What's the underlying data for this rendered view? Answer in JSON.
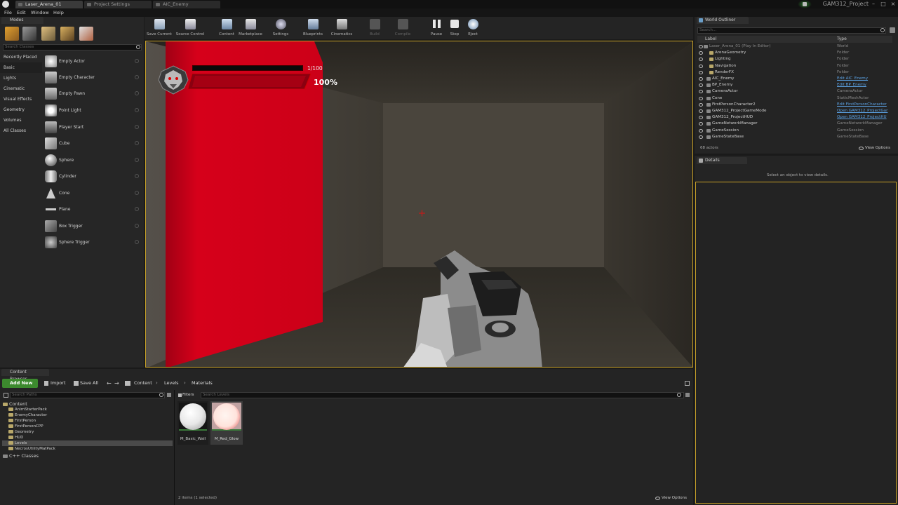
{
  "window": {
    "tabs": [
      "Laser_Arena_01",
      "Project Settings",
      "AIC_Enemy"
    ],
    "project_name": "GAM312_Project"
  },
  "menu": [
    "File",
    "Edit",
    "Window",
    "Help"
  ],
  "modes": {
    "tab": "Modes",
    "search_placeholder": "Search Classes",
    "categories": [
      "Recently Placed",
      "Basic",
      "Lights",
      "Cinematic",
      "Visual Effects",
      "Geometry",
      "Volumes",
      "All Classes"
    ],
    "selected_category": "Basic",
    "items": [
      "Empty Actor",
      "Empty Character",
      "Empty Pawn",
      "Point Light",
      "Player Start",
      "Cube",
      "Sphere",
      "Cylinder",
      "Cone",
      "Plane",
      "Box Trigger",
      "Sphere Trigger"
    ]
  },
  "toolbar": {
    "buttons": [
      "Save Current",
      "Source Control",
      "Content",
      "Marketplace",
      "Settings",
      "Blueprints",
      "Cinematics",
      "Build",
      "Compile",
      "Pause",
      "Stop",
      "Eject"
    ]
  },
  "hud": {
    "ammo": "1/100",
    "health": "100%"
  },
  "outliner": {
    "tab": "World Outliner",
    "search_placeholder": "Search...",
    "col_label": "Label",
    "col_type": "Type",
    "rows": [
      {
        "name": "Laser_Arena_01 (Play In Editor)",
        "type": "World",
        "link": false
      },
      {
        "name": "ArenaGeometry",
        "type": "Folder",
        "link": false
      },
      {
        "name": "Lighting",
        "type": "Folder",
        "link": false
      },
      {
        "name": "Navigation",
        "type": "Folder",
        "link": false
      },
      {
        "name": "RenderFX",
        "type": "Folder",
        "link": false
      },
      {
        "name": "AIC_Enemy",
        "type": "Edit AIC_Enemy",
        "link": true
      },
      {
        "name": "BP_Enemy",
        "type": "Edit BP_Enemy",
        "link": true
      },
      {
        "name": "CameraActor",
        "type": "CameraActor",
        "link": false
      },
      {
        "name": "Cone",
        "type": "StaticMeshActor",
        "link": false
      },
      {
        "name": "FirstPersonCharacter2",
        "type": "Edit FirstPersonCharacter",
        "link": true
      },
      {
        "name": "GAM312_ProjectGameMode",
        "type": "Open GAM312_ProjectGar",
        "link": true
      },
      {
        "name": "GAM312_ProjectHUD",
        "type": "Open GAM312_ProjectHU",
        "link": true
      },
      {
        "name": "GameNetworkManager",
        "type": "GameNetworkManager",
        "link": false
      },
      {
        "name": "GameSession",
        "type": "GameSession",
        "link": false
      },
      {
        "name": "GameStateBase",
        "type": "GameStateBase",
        "link": false
      }
    ],
    "count": "68 actors",
    "view_options": "View Options"
  },
  "details": {
    "tab": "Details",
    "message": "Select an object to view details."
  },
  "content_browser": {
    "tab": "Content Browser",
    "add_new": "Add New",
    "import": "Import",
    "save_all": "Save All",
    "breadcrumbs": [
      "Content",
      "Levels",
      "Materials"
    ],
    "search_paths_placeholder": "Search Paths",
    "filters": "Filters",
    "search_placeholder": "Search Levels",
    "tree": [
      "Content",
      "AnimStarterPack",
      "EnemyCharacter",
      "FirstPerson",
      "FirstPersonCPP",
      "Geometry",
      "HUD",
      "Levels",
      "NecrosUtilityMatPack",
      "C++ Classes"
    ],
    "assets": [
      {
        "name": "M_Basic_Wall",
        "color": "#e8e8e8"
      },
      {
        "name": "M_Red_Glow",
        "color": "#ffe3dc"
      }
    ],
    "status": "2 items (1 selected)",
    "view_options": "View Options"
  },
  "colors": {
    "accent": "#c9a227",
    "add_new": "#3c8a2e",
    "red_wall": "#d10018",
    "link": "#5a9fe0"
  }
}
